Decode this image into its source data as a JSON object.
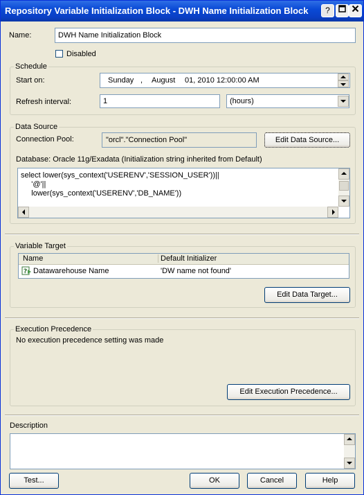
{
  "window": {
    "title": "Repository Variable Initialization Block - DWH Name Initialization Block",
    "minimize": "_",
    "close": "✕"
  },
  "general": {
    "name_label": "Name:",
    "name_value": "DWH Name Initialization Block",
    "disabled_label": "Disabled",
    "disabled_checked": false
  },
  "schedule": {
    "title": "Schedule",
    "start_label": "Start on:",
    "start_day": "Sunday",
    "start_sep": ",",
    "start_month": "August",
    "start_rest": "01, 2010 12:00:00 AM",
    "refresh_label": "Refresh interval:",
    "refresh_value": "1",
    "refresh_unit": "(hours)"
  },
  "data_source": {
    "title": "Data Source",
    "pool_label": "Connection Pool:",
    "pool_value": "\"orcl\".\"Connection Pool\"",
    "edit_button": "Edit Data Source...",
    "database_text": "Database: Oracle 11g/Exadata (Initialization string inherited from Default)",
    "sql_lines": [
      "select lower(sys_context('USERENV','SESSION_USER'))||",
      "     '@'||",
      "     lower(sys_context('USERENV','DB_NAME'))"
    ]
  },
  "variable_target": {
    "title": "Variable Target",
    "col_name": "Name",
    "col_default": "Default Initializer",
    "rows": [
      {
        "name": "Datawarehouse Name",
        "default": "'DW name not found'"
      }
    ],
    "edit_button": "Edit Data Target..."
  },
  "execution_precedence": {
    "title": "Execution Precedence",
    "message": "No execution precedence setting was made",
    "edit_button": "Edit Execution Precedence..."
  },
  "description": {
    "label": "Description",
    "value": ""
  },
  "footer": {
    "test": "Test...",
    "ok": "OK",
    "cancel": "Cancel",
    "help": "Help"
  },
  "colors": {
    "title_bar": "#0a4ad6",
    "dialog_bg": "#ece9d8",
    "field_border": "#7f9db9"
  }
}
